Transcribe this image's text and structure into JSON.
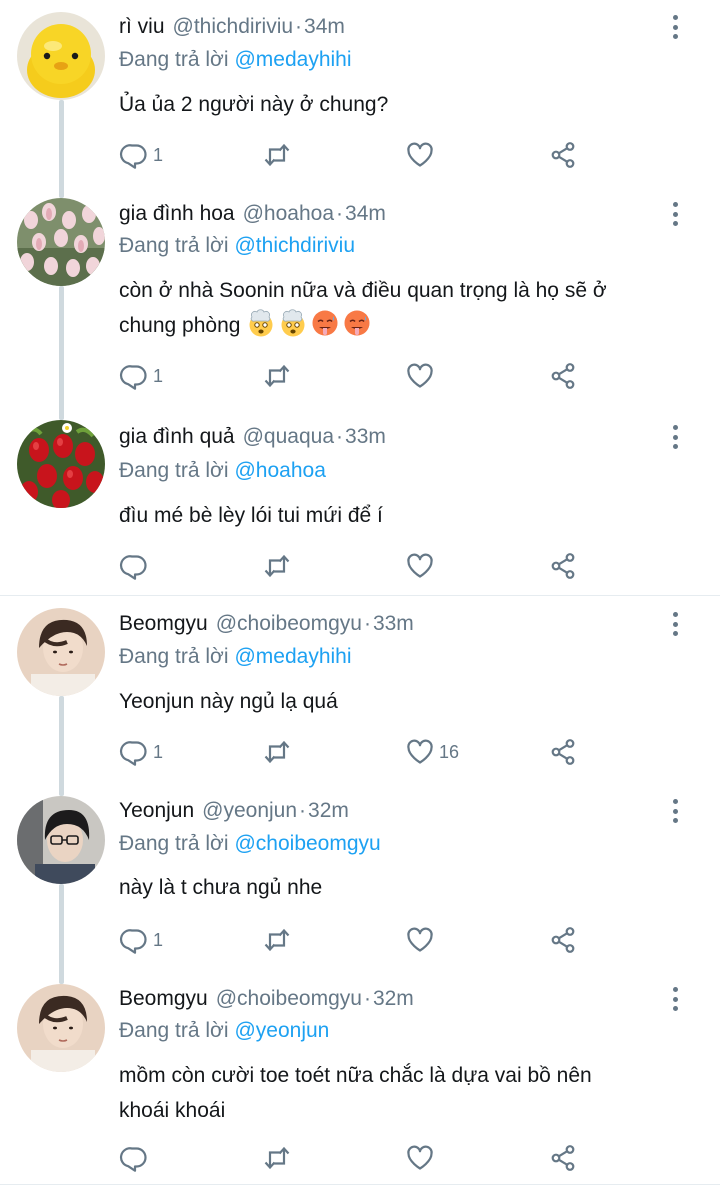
{
  "tweets": [
    {
      "name": "rì viu",
      "handle": "@thichdiriviu",
      "time": "34m",
      "reply_prefix": "Đang trả lời",
      "reply_to": "@medayhihi",
      "text": "Ủa ủa 2 người này ở chung?",
      "reply_count": "1",
      "like_count": "",
      "avatar": "yellow-duck-avatar"
    },
    {
      "name": "gia đình hoa",
      "handle": "@hoahoa",
      "time": "34m",
      "reply_prefix": "Đang trả lời",
      "reply_to": "@thichdiriviu",
      "text_line1": "còn ở nhà Soonin nữa và điều quan trọng là họ sẽ ở",
      "text_line2": "chung phòng",
      "emojis": [
        "exploding-head",
        "exploding-head",
        "hot-face",
        "hot-face"
      ],
      "reply_count": "1",
      "like_count": "",
      "avatar": "tulips-avatar"
    },
    {
      "name": "gia đình quả",
      "handle": "@quaqua",
      "time": "33m",
      "reply_prefix": "Đang trả lời",
      "reply_to": "@hoahoa",
      "text": "đìu mé bè lèy lói tui mứi để í",
      "reply_count": "",
      "like_count": "",
      "avatar": "strawberries-avatar"
    },
    {
      "name": "Beomgyu",
      "handle": "@choibeomgyu",
      "time": "33m",
      "reply_prefix": "Đang trả lời",
      "reply_to": "@medayhihi",
      "text": "Yeonjun này ngủ lạ quá",
      "reply_count": "1",
      "like_count": "16",
      "avatar": "beomgyu-avatar"
    },
    {
      "name": "Yeonjun",
      "handle": "@yeonjun",
      "time": "32m",
      "reply_prefix": "Đang trả lời",
      "reply_to": "@choibeomgyu",
      "text": "này là t chưa ngủ nhe",
      "reply_count": "1",
      "like_count": "",
      "avatar": "yeonjun-avatar"
    },
    {
      "name": "Beomgyu",
      "handle": "@choibeomgyu",
      "time": "32m",
      "reply_prefix": "Đang trả lời",
      "reply_to": "@yeonjun",
      "text_line1": "mồm còn cười toe toét nữa chắc là dựa vai bồ nên",
      "text_line2": "khoái khoái",
      "reply_count": "",
      "like_count": "",
      "avatar": "beomgyu-avatar"
    }
  ],
  "icons": {
    "reply": "reply-icon",
    "retweet": "retweet-icon",
    "like": "like-icon",
    "share": "share-icon",
    "more": "more-options-icon"
  },
  "colors": {
    "mention": "#1da1f2",
    "secondary_text": "#657786",
    "thread_line": "#cfd9de"
  }
}
